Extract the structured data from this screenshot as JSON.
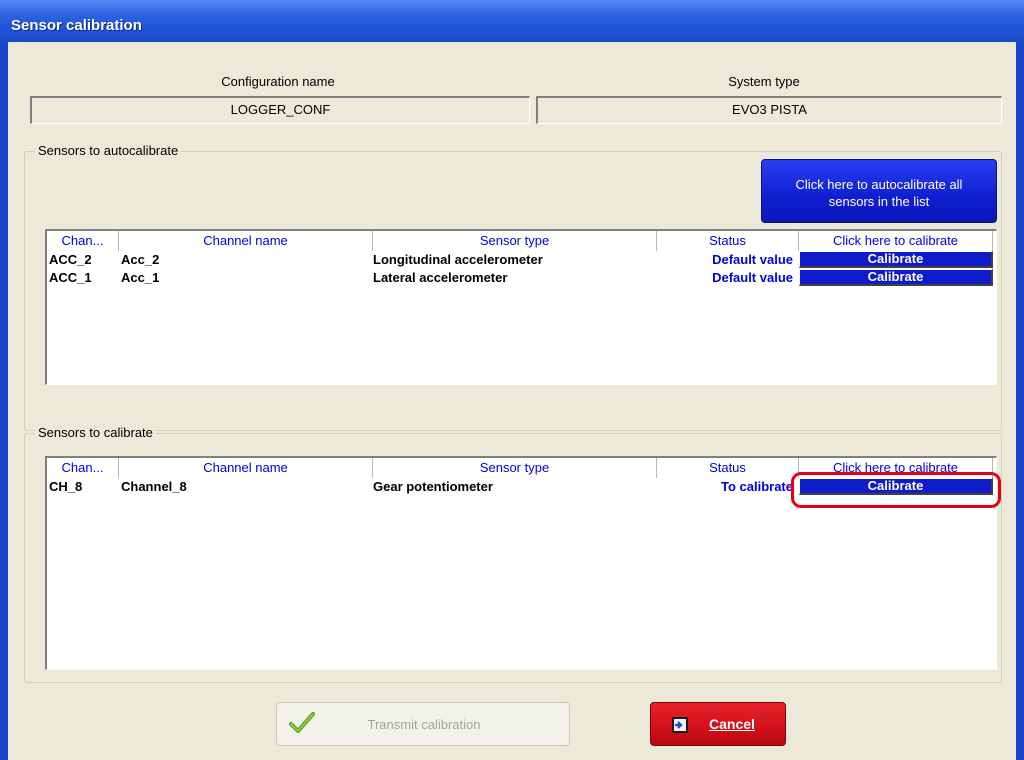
{
  "window": {
    "title": "Sensor calibration"
  },
  "config": {
    "label": "Configuration name",
    "value": "LOGGER_CONF"
  },
  "system": {
    "label": "System type",
    "value": "EVO3 PISTA"
  },
  "autocal": {
    "group_label": "Sensors to autocalibrate",
    "button_line1": "Click here to autocalibrate all",
    "button_line2": "sensors  in the list",
    "columns": [
      "Chan...",
      "Channel name",
      "Sensor type",
      "Status",
      "Click here to calibrate"
    ],
    "rows": [
      {
        "chan": "ACC_2",
        "name": "Acc_2",
        "type": "Longitudinal accelerometer",
        "status": "Default value",
        "action": "Calibrate"
      },
      {
        "chan": "ACC_1",
        "name": "Acc_1",
        "type": "Lateral accelerometer",
        "status": "Default value",
        "action": "Calibrate"
      }
    ]
  },
  "calib": {
    "group_label": "Sensors to calibrate",
    "columns": [
      "Chan...",
      "Channel name",
      "Sensor type",
      "Status",
      "Click here to calibrate"
    ],
    "rows": [
      {
        "chan": "CH_8",
        "name": "Channel_8",
        "type": "Gear potentiometer",
        "status": "To calibrate",
        "action": "Calibrate"
      }
    ]
  },
  "buttons": {
    "transmit": "Transmit calibration",
    "cancel": "Cancel"
  },
  "icons": {
    "transmit": "checkmark-icon",
    "cancel": "exit-door-icon"
  },
  "colors": {
    "accent_blue": "#0f1ccc",
    "status_blue": "#0000e0",
    "cancel_red": "#d11019",
    "highlight_red": "#e2001a"
  }
}
